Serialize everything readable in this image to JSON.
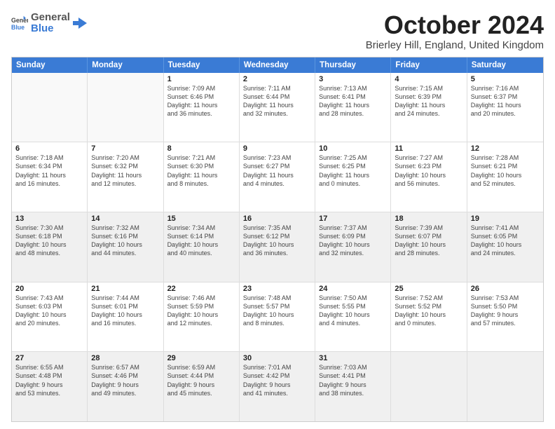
{
  "logo": {
    "general": "General",
    "blue": "Blue"
  },
  "title": "October 2024",
  "location": "Brierley Hill, England, United Kingdom",
  "headers": [
    "Sunday",
    "Monday",
    "Tuesday",
    "Wednesday",
    "Thursday",
    "Friday",
    "Saturday"
  ],
  "rows": [
    [
      {
        "day": "",
        "info": "",
        "empty": true
      },
      {
        "day": "",
        "info": "",
        "empty": true
      },
      {
        "day": "1",
        "info": "Sunrise: 7:09 AM\nSunset: 6:46 PM\nDaylight: 11 hours\nand 36 minutes."
      },
      {
        "day": "2",
        "info": "Sunrise: 7:11 AM\nSunset: 6:44 PM\nDaylight: 11 hours\nand 32 minutes."
      },
      {
        "day": "3",
        "info": "Sunrise: 7:13 AM\nSunset: 6:41 PM\nDaylight: 11 hours\nand 28 minutes."
      },
      {
        "day": "4",
        "info": "Sunrise: 7:15 AM\nSunset: 6:39 PM\nDaylight: 11 hours\nand 24 minutes."
      },
      {
        "day": "5",
        "info": "Sunrise: 7:16 AM\nSunset: 6:37 PM\nDaylight: 11 hours\nand 20 minutes."
      }
    ],
    [
      {
        "day": "6",
        "info": "Sunrise: 7:18 AM\nSunset: 6:34 PM\nDaylight: 11 hours\nand 16 minutes."
      },
      {
        "day": "7",
        "info": "Sunrise: 7:20 AM\nSunset: 6:32 PM\nDaylight: 11 hours\nand 12 minutes."
      },
      {
        "day": "8",
        "info": "Sunrise: 7:21 AM\nSunset: 6:30 PM\nDaylight: 11 hours\nand 8 minutes."
      },
      {
        "day": "9",
        "info": "Sunrise: 7:23 AM\nSunset: 6:27 PM\nDaylight: 11 hours\nand 4 minutes."
      },
      {
        "day": "10",
        "info": "Sunrise: 7:25 AM\nSunset: 6:25 PM\nDaylight: 11 hours\nand 0 minutes."
      },
      {
        "day": "11",
        "info": "Sunrise: 7:27 AM\nSunset: 6:23 PM\nDaylight: 10 hours\nand 56 minutes."
      },
      {
        "day": "12",
        "info": "Sunrise: 7:28 AM\nSunset: 6:21 PM\nDaylight: 10 hours\nand 52 minutes."
      }
    ],
    [
      {
        "day": "13",
        "info": "Sunrise: 7:30 AM\nSunset: 6:18 PM\nDaylight: 10 hours\nand 48 minutes.",
        "shaded": true
      },
      {
        "day": "14",
        "info": "Sunrise: 7:32 AM\nSunset: 6:16 PM\nDaylight: 10 hours\nand 44 minutes.",
        "shaded": true
      },
      {
        "day": "15",
        "info": "Sunrise: 7:34 AM\nSunset: 6:14 PM\nDaylight: 10 hours\nand 40 minutes.",
        "shaded": true
      },
      {
        "day": "16",
        "info": "Sunrise: 7:35 AM\nSunset: 6:12 PM\nDaylight: 10 hours\nand 36 minutes.",
        "shaded": true
      },
      {
        "day": "17",
        "info": "Sunrise: 7:37 AM\nSunset: 6:09 PM\nDaylight: 10 hours\nand 32 minutes.",
        "shaded": true
      },
      {
        "day": "18",
        "info": "Sunrise: 7:39 AM\nSunset: 6:07 PM\nDaylight: 10 hours\nand 28 minutes.",
        "shaded": true
      },
      {
        "day": "19",
        "info": "Sunrise: 7:41 AM\nSunset: 6:05 PM\nDaylight: 10 hours\nand 24 minutes.",
        "shaded": true
      }
    ],
    [
      {
        "day": "20",
        "info": "Sunrise: 7:43 AM\nSunset: 6:03 PM\nDaylight: 10 hours\nand 20 minutes."
      },
      {
        "day": "21",
        "info": "Sunrise: 7:44 AM\nSunset: 6:01 PM\nDaylight: 10 hours\nand 16 minutes."
      },
      {
        "day": "22",
        "info": "Sunrise: 7:46 AM\nSunset: 5:59 PM\nDaylight: 10 hours\nand 12 minutes."
      },
      {
        "day": "23",
        "info": "Sunrise: 7:48 AM\nSunset: 5:57 PM\nDaylight: 10 hours\nand 8 minutes."
      },
      {
        "day": "24",
        "info": "Sunrise: 7:50 AM\nSunset: 5:55 PM\nDaylight: 10 hours\nand 4 minutes."
      },
      {
        "day": "25",
        "info": "Sunrise: 7:52 AM\nSunset: 5:52 PM\nDaylight: 10 hours\nand 0 minutes."
      },
      {
        "day": "26",
        "info": "Sunrise: 7:53 AM\nSunset: 5:50 PM\nDaylight: 9 hours\nand 57 minutes."
      }
    ],
    [
      {
        "day": "27",
        "info": "Sunrise: 6:55 AM\nSunset: 4:48 PM\nDaylight: 9 hours\nand 53 minutes.",
        "shaded": true
      },
      {
        "day": "28",
        "info": "Sunrise: 6:57 AM\nSunset: 4:46 PM\nDaylight: 9 hours\nand 49 minutes.",
        "shaded": true
      },
      {
        "day": "29",
        "info": "Sunrise: 6:59 AM\nSunset: 4:44 PM\nDaylight: 9 hours\nand 45 minutes.",
        "shaded": true
      },
      {
        "day": "30",
        "info": "Sunrise: 7:01 AM\nSunset: 4:42 PM\nDaylight: 9 hours\nand 41 minutes.",
        "shaded": true
      },
      {
        "day": "31",
        "info": "Sunrise: 7:03 AM\nSunset: 4:41 PM\nDaylight: 9 hours\nand 38 minutes.",
        "shaded": true
      },
      {
        "day": "",
        "info": "",
        "empty": true,
        "shaded": true
      },
      {
        "day": "",
        "info": "",
        "empty": true,
        "shaded": true
      }
    ]
  ]
}
